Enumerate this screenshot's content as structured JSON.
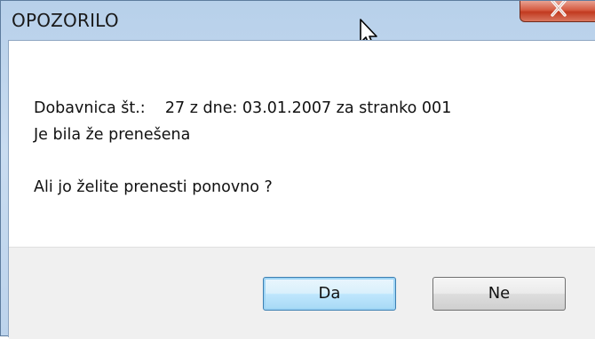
{
  "window": {
    "title": "OPOZORILO"
  },
  "message": {
    "line1": "Dobavnica št.:    27 z dne: 03.01.2007 za stranko 001",
    "line2": "Je bila že prenešena",
    "line3": "Ali jo želite prenesti ponovno ?"
  },
  "buttons": {
    "yes_label": "Da",
    "no_label": "Ne"
  },
  "icons": {
    "close": "close-icon",
    "cursor": "mouse-pointer-icon"
  },
  "colors": {
    "title_bar": "#c4d9ef",
    "close_button": "#c9472e",
    "default_button_border": "#3c7fb1",
    "footer": "#f0f0f0"
  }
}
